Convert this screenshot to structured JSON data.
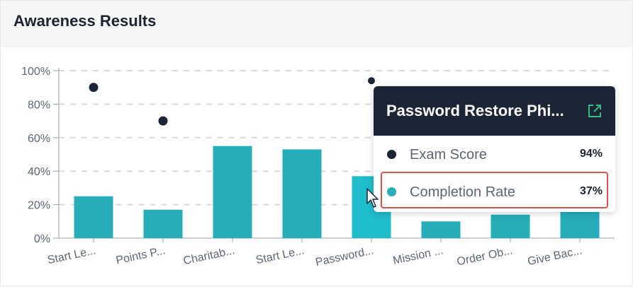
{
  "card": {
    "title": "Awareness Results"
  },
  "colors": {
    "bar": "#26adb8",
    "bar_hover": "#1fbccc",
    "dot": "#1c2535",
    "grid": "#d8dadf",
    "highlight": "#d9534f",
    "link_icon": "#2fbf83"
  },
  "chart_data": {
    "type": "bar",
    "categories": [
      "Start Le...",
      "Points P...",
      "Charitab...",
      "Start Le...",
      "Password...",
      "Mission ...",
      "Order Ob...",
      "Give Bac..."
    ],
    "series": [
      {
        "name": "Completion Rate",
        "type": "bar",
        "values": [
          25,
          17,
          55,
          53,
          37,
          10,
          14,
          17
        ]
      },
      {
        "name": "Exam Score",
        "type": "scatter",
        "values": [
          90,
          70,
          null,
          null,
          94,
          null,
          null,
          null
        ]
      }
    ],
    "yticks": [
      "0%",
      "20%",
      "40%",
      "60%",
      "80%",
      "100%"
    ],
    "ylim": [
      0,
      100
    ],
    "grid": true,
    "highlighted_index": 4
  },
  "tooltip": {
    "title": "Password Restore Phi...",
    "link_icon": "external-link-icon",
    "rows": [
      {
        "label": "Exam Score",
        "value": "94%"
      },
      {
        "label": "Completion Rate",
        "value": "37%"
      }
    ]
  }
}
